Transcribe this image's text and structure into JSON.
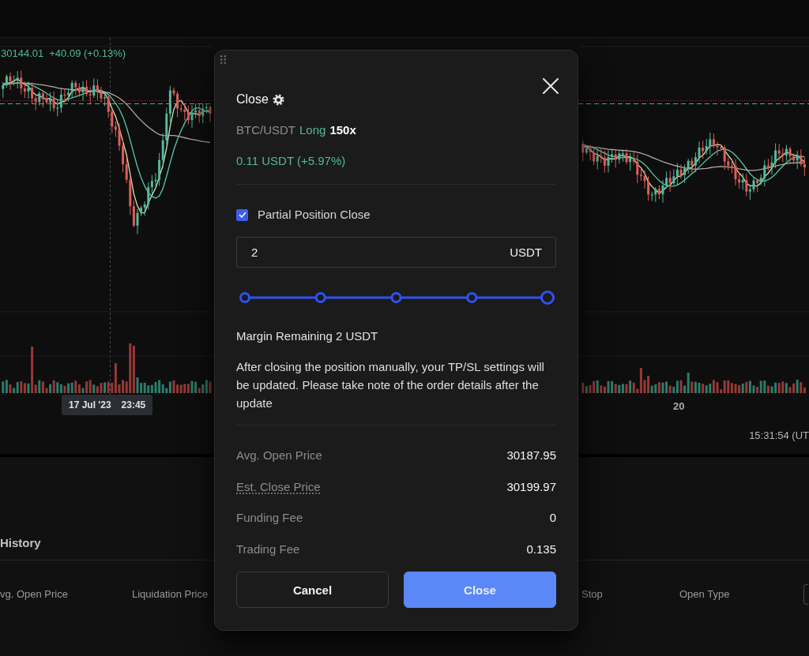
{
  "chart": {
    "last_price": "30144.01",
    "price_change": "+40.09 (+0.13%)",
    "crosshair_label": {
      "date": "17 Jul '23",
      "time": "23:45"
    },
    "time_axis_label": "20",
    "clock": "15:31:54 (UT"
  },
  "dialog": {
    "title": "Close",
    "pair": "BTC/USDT",
    "side": {
      "label": "Long",
      "kind": "long"
    },
    "leverage": "150x",
    "pnl": {
      "text": "0.11 USDT (+5.97%)",
      "kind": "profit"
    },
    "partial_close": {
      "label": "Partial Position Close",
      "checked": true
    },
    "amount": {
      "value": "2",
      "unit": "USDT"
    },
    "slider": {
      "level": 1
    },
    "margin_remaining": "Margin Remaining 2 USDT",
    "notice": "After closing the position manually, your TP/SL settings will be updated. Please take note of the order details after the update",
    "details": [
      {
        "label": "Avg. Open Price",
        "value": "30187.95",
        "kind": "plain"
      },
      {
        "label": "Est. Close Price",
        "value": "30199.97",
        "kind": "hint"
      },
      {
        "label": "Funding Fee",
        "value": "0",
        "kind": "plain"
      },
      {
        "label": "Trading Fee",
        "value": "0.135",
        "kind": "plain"
      }
    ],
    "buttons": [
      {
        "label": "Cancel",
        "kind": "secondary"
      },
      {
        "label": "Close",
        "kind": "primary"
      }
    ]
  },
  "positions": {
    "title": "History",
    "columns": [
      "vg. Open Price",
      "Liquidation Price",
      "Stop",
      "Open Type"
    ]
  }
}
